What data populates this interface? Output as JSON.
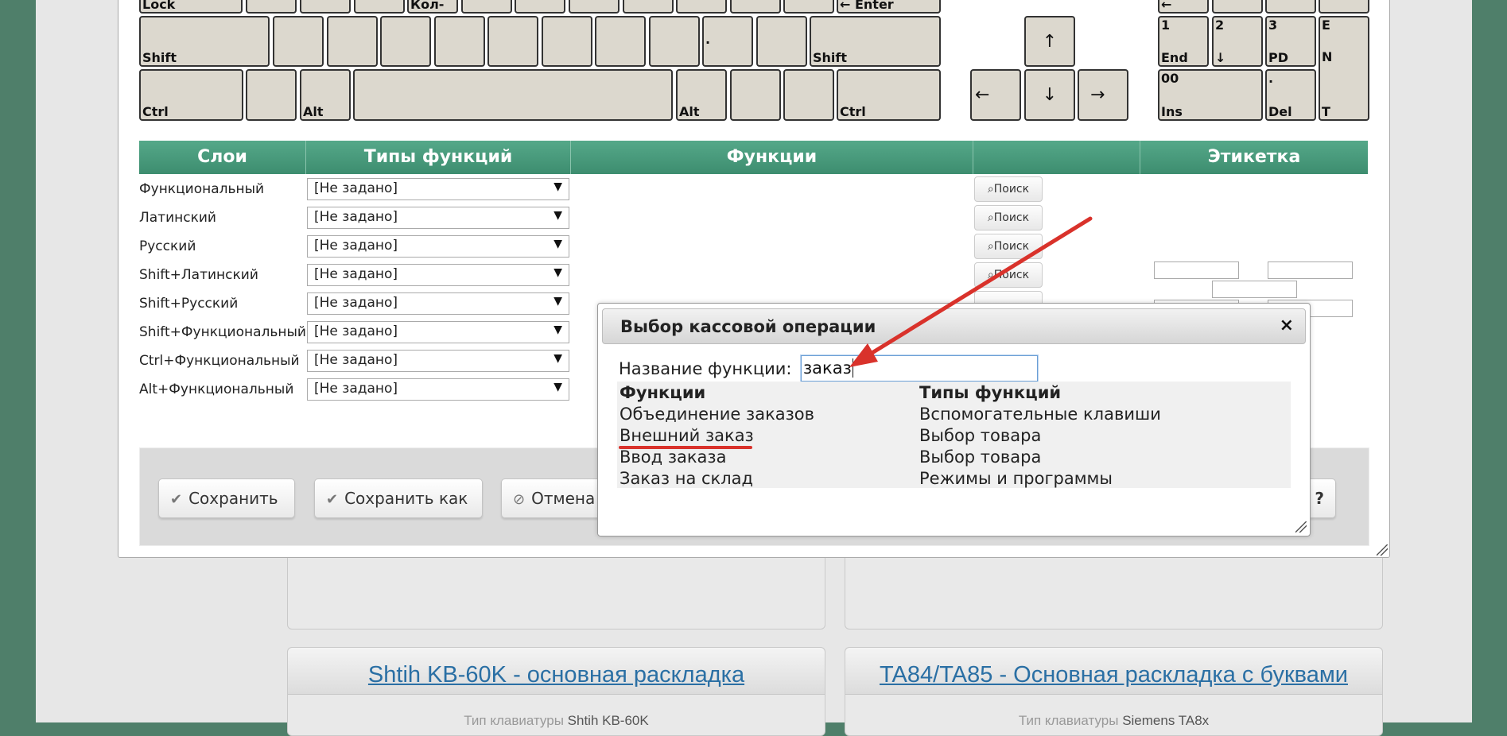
{
  "keyboard": {
    "row1": {
      "lock": "Lock",
      "kol": "Кол-",
      "enter": "← Enter",
      "nav_top": "←"
    },
    "row2": {
      "shift_left": "Shift",
      "dot": ".",
      "shift_right": "Shift",
      "arrow_up": "↑",
      "np1_top": "1",
      "np1_bottom": "End",
      "np2_top": "2",
      "np2_mid": "↓",
      "np3_top": "3",
      "np3_bottom": "PD",
      "npE_top": "E",
      "npE_mid": "N",
      "npE_bottom": "T"
    },
    "row3": {
      "ctrl_left": "Ctrl",
      "alt_left": "Alt",
      "alt_right": "Alt",
      "ctrl_right": "Ctrl",
      "arrow_left": "←",
      "arrow_down": "↓",
      "arrow_right": "→",
      "np00_top": "00",
      "np00_bottom": "Ins",
      "npdot_top": ".",
      "npdot_bottom": "Del"
    }
  },
  "layers_table": {
    "headers": [
      "Слои",
      "Типы функций",
      "Функции",
      "",
      "Этикетка"
    ],
    "rows": [
      {
        "name": "Функциональный",
        "type": "[Не задано]",
        "search": "Поиск"
      },
      {
        "name": "Латинский",
        "type": "[Не задано]",
        "search": "Поиск"
      },
      {
        "name": "Русский",
        "type": "[Не задано]",
        "search": "Поиск"
      },
      {
        "name": "Shift+Латинский",
        "type": "[Не задано]",
        "search": "Поиск"
      },
      {
        "name": "Shift+Русский",
        "type": "[Не задано]",
        "search": ""
      },
      {
        "name": "Shift+Функциональный",
        "type": "[Не задано]",
        "search": ""
      },
      {
        "name": "Ctrl+Функциональный",
        "type": "[Не задано]",
        "search": ""
      },
      {
        "name": "Alt+Функциональный",
        "type": "[Не задано]",
        "search": ""
      }
    ]
  },
  "footer": {
    "save": "Сохранить",
    "save_as": "Сохранить как",
    "cancel": "Отмена",
    "help": "?"
  },
  "dialog": {
    "title": "Выбор кассовой операции",
    "close": "×",
    "label": "Название функции:",
    "input_value": "заказ",
    "col_functions": "Функции",
    "col_types": "Типы функций",
    "results": [
      {
        "function": "Объединение заказов",
        "type": "Вспомогательные клавиши"
      },
      {
        "function": "Внешний заказ",
        "type": "Выбор товара"
      },
      {
        "function": "Ввод заказа",
        "type": "Выбор товара"
      },
      {
        "function": "Заказ на склад",
        "type": "Режимы и программы"
      }
    ]
  },
  "cards": [
    {
      "title": "Shtih KB-60K - основная раскладка",
      "kb_label": "Тип клавиатуры",
      "kb_value": "Shtih KB-60K"
    },
    {
      "title": "TA84/TA85 - Основная раскладка с буквами",
      "kb_label": "Тип клавиатуры",
      "kb_value": "Siemens TA8x"
    }
  ],
  "colors": {
    "header_green": "#4a9a7c",
    "key_fill": "#dcd8ce",
    "annotation_red": "#d9322b",
    "link_blue": "#2a6fa4"
  }
}
